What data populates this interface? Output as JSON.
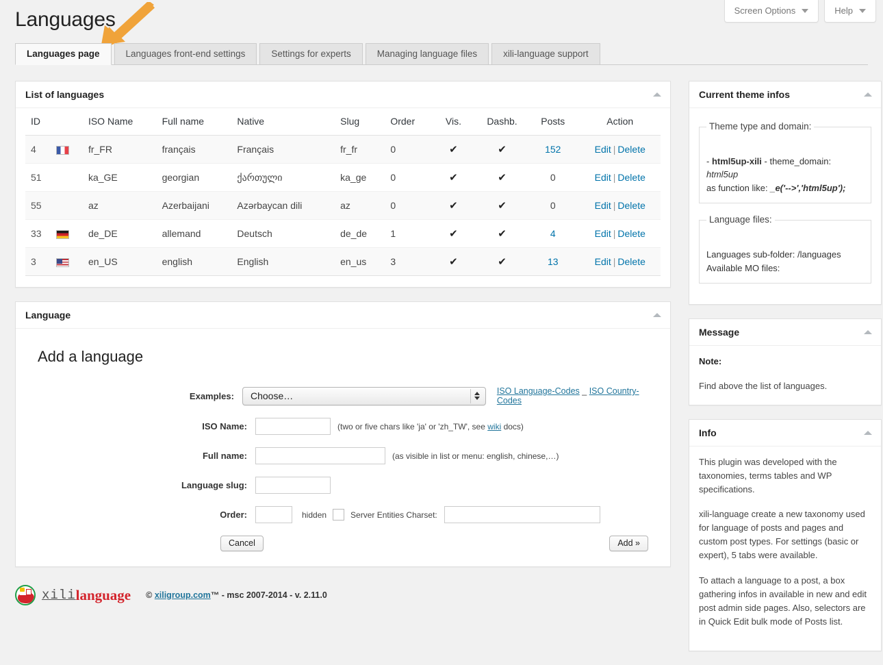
{
  "topbar": {
    "screen_options": "Screen Options",
    "help": "Help"
  },
  "page": {
    "title": "Languages"
  },
  "tabs": [
    {
      "label": "Languages page",
      "active": true
    },
    {
      "label": "Languages front-end settings",
      "active": false
    },
    {
      "label": "Settings for experts",
      "active": false
    },
    {
      "label": "Managing language files",
      "active": false
    },
    {
      "label": "xili-language support",
      "active": false
    }
  ],
  "list_panel": {
    "title": "List of languages",
    "columns": [
      "ID",
      "",
      "ISO Name",
      "Full name",
      "Native",
      "Slug",
      "Order",
      "Vis.",
      "Dashb.",
      "Posts",
      "Action"
    ],
    "check_glyph": "✔",
    "edit_label": "Edit",
    "delete_label": "Delete",
    "separator": "|",
    "rows": [
      {
        "id": "4",
        "flag": "fr",
        "iso": "fr_FR",
        "full": "français",
        "native": "Français",
        "slug": "fr_fr",
        "order": "0",
        "vis": true,
        "dashb": true,
        "posts": "152"
      },
      {
        "id": "51",
        "flag": "",
        "iso": "ka_GE",
        "full": "georgian",
        "native": "ქართული",
        "slug": "ka_ge",
        "order": "0",
        "vis": true,
        "dashb": true,
        "posts": "0"
      },
      {
        "id": "55",
        "flag": "",
        "iso": "az",
        "full": "Azerbaijani",
        "native": "Azərbaycan dili",
        "slug": "az",
        "order": "0",
        "vis": true,
        "dashb": true,
        "posts": "0"
      },
      {
        "id": "33",
        "flag": "de",
        "iso": "de_DE",
        "full": "allemand",
        "native": "Deutsch",
        "slug": "de_de",
        "order": "1",
        "vis": true,
        "dashb": true,
        "posts": "4"
      },
      {
        "id": "3",
        "flag": "us",
        "iso": "en_US",
        "full": "english",
        "native": "English",
        "slug": "en_us",
        "order": "3",
        "vis": true,
        "dashb": true,
        "posts": "13"
      }
    ]
  },
  "language_panel": {
    "title": "Language",
    "heading": "Add a language",
    "examples_label": "Examples:",
    "examples_value": "Choose…",
    "iso_lang_codes_link": "ISO Language-Codes",
    "link_divider": "_",
    "iso_country_codes_link": "ISO Country-Codes",
    "iso_name_label": "ISO Name:",
    "iso_name_value": "",
    "iso_name_hint_pre": "(two or five chars like 'ja' or 'zh_TW', see ",
    "iso_name_hint_link": "wiki",
    "iso_name_hint_post": " docs)",
    "full_name_label": "Full name:",
    "full_name_value": "",
    "full_name_hint": "(as visible in list or menu: english, chinese,…)",
    "slug_label": "Language slug:",
    "slug_value": "",
    "order_label": "Order:",
    "order_value": "",
    "hidden_label": "hidden",
    "charset_label": "Server Entities Charset:",
    "charset_value": "",
    "cancel_label": "Cancel",
    "add_label": "Add »"
  },
  "footer": {
    "logo_part1": "xili",
    "logo_part2": "language",
    "copyright_pre": "© ",
    "copyright_link": "xiligroup.com",
    "copyright_post": "™ - msc 2007-2014 - v. 2.11.0"
  },
  "sidebar": {
    "theme_box": {
      "title": "Current theme infos",
      "fieldset1_legend": "Theme type and domain:",
      "line1_pre": "- ",
      "line1_bold": "html5up-xili",
      "line1_post": " - theme_domain:",
      "line2_italic": "html5up",
      "line3_pre": "as function like: ",
      "line3_italic": "_e('-->','html5up');",
      "fieldset2_legend": "Language files:",
      "lang_subfolder": "Languages sub-folder: /languages",
      "available_mo": "Available MO files:"
    },
    "message_box": {
      "title": "Message",
      "note_label": "Note:",
      "note_text": "Find above the list of languages."
    },
    "info_box": {
      "title": "Info",
      "paragraph1": "This plugin was developed with the taxonomies, terms tables and WP specifications.",
      "paragraph2": "xili-language create a new taxonomy used for language of posts and pages and custom post types. For settings (basic or expert), 5 tabs were available.",
      "paragraph3": "To attach a language to a post, a box gathering infos in available in new and edit post admin side pages. Also, selectors are in Quick Edit bulk mode of Posts list."
    }
  },
  "colors": {
    "page_bg": "#f1f1f1",
    "link": "#0073aa",
    "link_underline": "#21759b",
    "arrow": "#f0a33a",
    "logo_red": "#d3242c"
  }
}
